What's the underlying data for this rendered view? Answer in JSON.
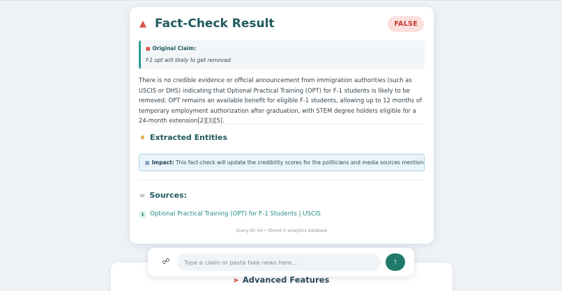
{
  "result": {
    "title": "Fact-Check Result",
    "verdict": "FALSE",
    "icon": "alarm-bell-icon",
    "claim_label": "Original Claim:",
    "claim_text": "f-1 opt will likely to get removed",
    "explanation": "There is no credible evidence or official announcement from immigration authorities (such as USCIS or DHS) indicating that Optional Practical Training (OPT) for F-1 students is likely to be removed. OPT remains an available benefit for eligible F-1 students, allowing up to 12 months of temporary employment authorization after graduation, with STEM degree holders eligible for a 24-month extension[2][3][5].",
    "entities_title": "Extracted Entities",
    "impact_label": "Impact:",
    "impact_text": " This fact-check will update the credibility scores for the politicians and media sources mentioned above.",
    "sources_title": "Sources:",
    "sources": [
      {
        "num": "1",
        "title": "Optional Practical Training (OPT) for F-1 Students | USCIS"
      }
    ],
    "footer_note": "Query ID: 64 • Stored in analytics database"
  },
  "composer": {
    "placeholder": "Type a claim or paste fake news here...",
    "value": "",
    "send_icon": "arrow-up-icon",
    "attach_icon": "paperclip-icon"
  },
  "advanced": {
    "title": "Advanced Features",
    "icon": "rocket-icon"
  },
  "colors": {
    "accent": "#1f7a6a",
    "heading": "#1f5a5f",
    "verdict_bg": "#fde0e0",
    "verdict_text": "#c0392b"
  }
}
